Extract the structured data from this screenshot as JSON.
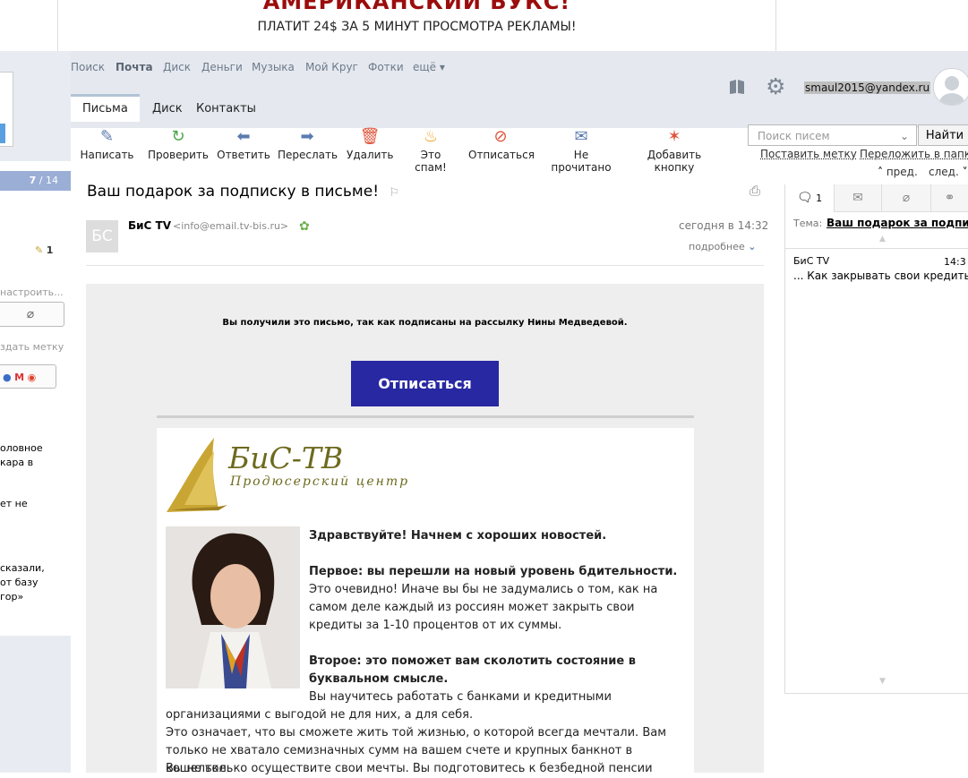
{
  "banner": {
    "headline": "АМЕРИКАНСКИЙ БУКС!",
    "subline": "ПЛАТИТ 24$ ЗА 5 МИНУТ ПРОСМОТРА РЕКЛАМЫ!"
  },
  "nav": {
    "items": [
      "Поиск",
      "Почта",
      "Диск",
      "Деньги",
      "Музыка",
      "Мой Круг",
      "Фотки",
      "ещё ▾"
    ]
  },
  "user": {
    "email": "smaul2015@yandex.ru"
  },
  "tabs": [
    "Письма",
    "Диск",
    "Контакты"
  ],
  "toolbar": {
    "compose": "Написать",
    "check": "Проверить",
    "reply": "Ответить",
    "forward": "Переслать",
    "delete": "Удалить",
    "spam": "Это спам!",
    "unsubscribe": "Отписаться",
    "unread": "Не прочитано",
    "add_button": "Добавить кнопку"
  },
  "search": {
    "placeholder": "Поиск писем",
    "button": "Найти",
    "set_label": "Поставить метку",
    "move_folder": "Переложить в папку",
    "prev": "пред.",
    "next": "след."
  },
  "left": {
    "counter_current": "7",
    "counter_sep": "/",
    "counter_total": "14",
    "badge": "1",
    "configure": "настроить...",
    "create_label": "здать метку",
    "snippet1": "оловное\nкара в",
    "snippet2": "ет не",
    "snippet3": "сказали,\nот базу\nгор»"
  },
  "message": {
    "subject": "Ваш подарок за подписку в письме!",
    "avatar": "БС",
    "sender_name": "БиС TV",
    "sender_email": "<info@email.tv-bis.ru>",
    "time": "сегодня в 14:32",
    "details": "подробнее"
  },
  "body": {
    "notice": "Вы получили это письмо, так как подписаны на рассылку Нины Медведевой.",
    "unsubscribe": "Отписаться",
    "logo_name": "БиС-ТВ",
    "logo_sub": "Продюсерский центр",
    "greeting": "Здравствуйте! Начнем с хороших новостей.",
    "p1_title": "Первое: вы перешли на новый уровень бдительности.",
    "p1_text": "Это очевидно! Иначе вы бы не задумались о том, как на самом деле каждый из россиян может закрыть свои кредиты за 1-10 процентов от их суммы.",
    "p2_title": "Второе: это поможет вам сколотить состояние в буквальном смысле.",
    "p2_text1": "Вы научитесь работать с банками и кредитными организациями с выгодой не для них, а для себя.",
    "p2_text2": "Это означает, что вы сможете жить той жизнью, о которой всегда мечтали. Вам только не хватало семизначных сумм на вашем счете и крупных банкнот в кошельке.",
    "p2_text3": "Вы не только осуществите свои мечты. Вы подготовитесь к безбедной пенсии"
  },
  "thread": {
    "count": "1",
    "topic_label": "Тема:",
    "topic": "Ваш подарок за подпи...",
    "item_sender": "БиС TV",
    "item_time": "14:3",
    "item_snippet": "... Как закрывать свои кредиты..."
  }
}
